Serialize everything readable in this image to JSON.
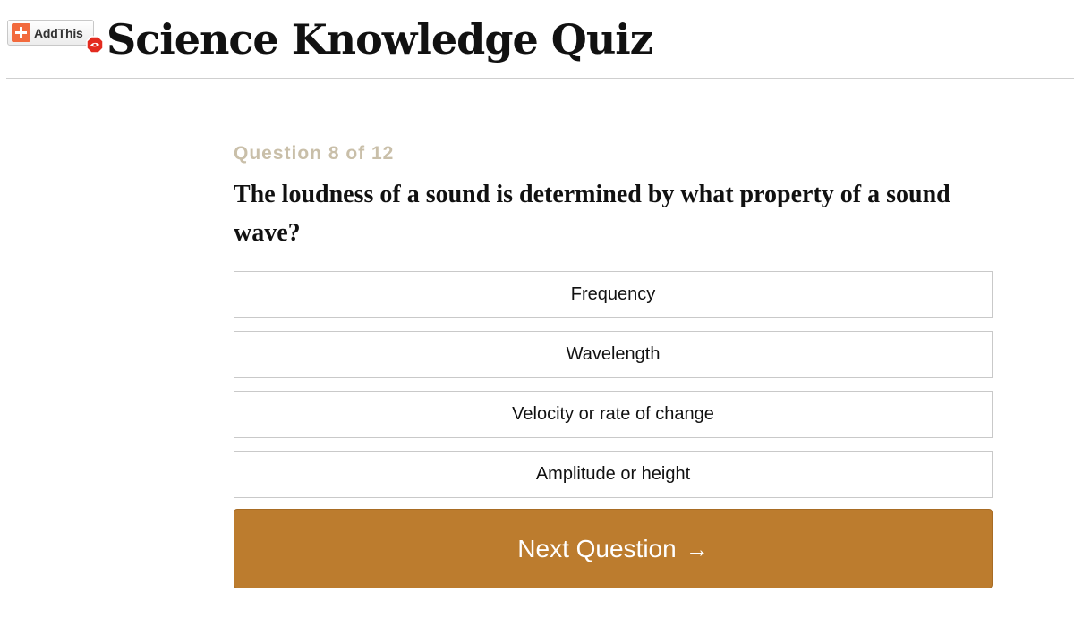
{
  "header": {
    "share_button_label": "AddThis",
    "title": "Science Knowledge Quiz"
  },
  "quiz": {
    "counter": "Question 8 of 12",
    "question": "The loudness of a sound is determined by what property of a sound wave?",
    "answers": [
      {
        "label": "Frequency"
      },
      {
        "label": "Wavelength"
      },
      {
        "label": "Velocity or rate of change"
      },
      {
        "label": "Amplitude or height"
      }
    ],
    "next_label": "Next Question",
    "next_arrow": "→"
  },
  "colors": {
    "accent": "#bc7c2e",
    "counter": "#c9bfa9",
    "addthis": "#f26a3d",
    "adblock": "#e32b1f"
  },
  "icons": {
    "share": "plus-icon",
    "adblock": "adblock-badge-icon",
    "next": "arrow-right-icon"
  }
}
